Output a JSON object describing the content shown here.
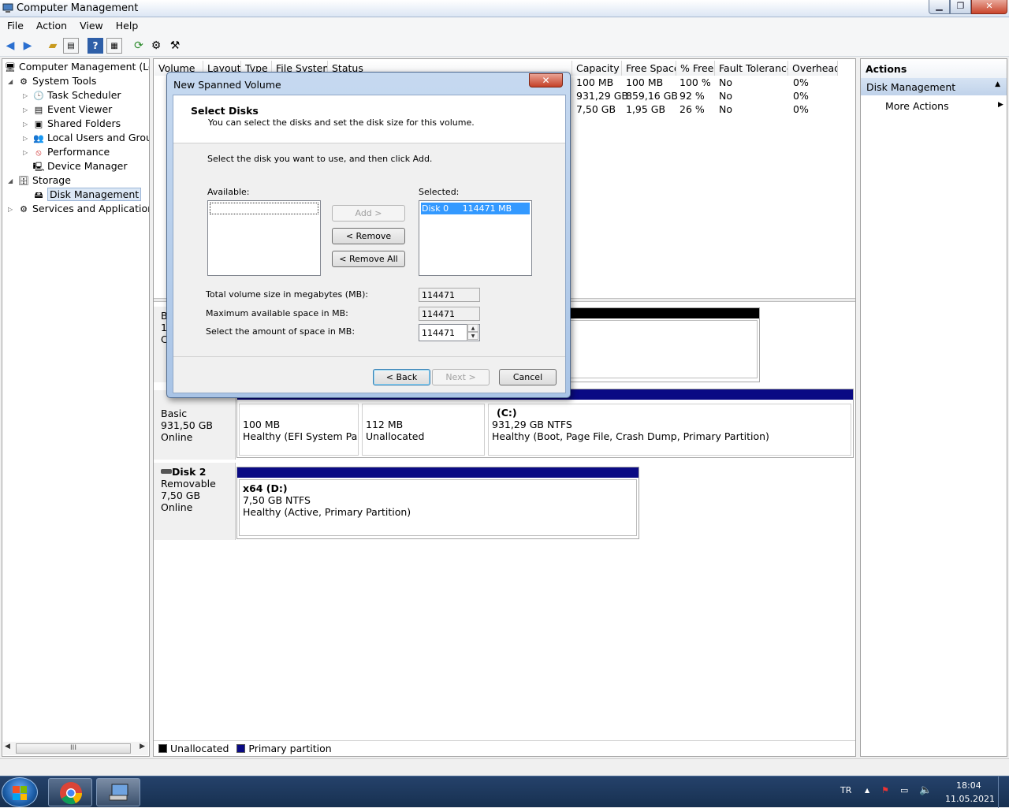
{
  "window": {
    "title": "Computer Management"
  },
  "menu": [
    "File",
    "Action",
    "View",
    "Help"
  ],
  "toolbar": {
    "icons": [
      "back-icon",
      "forward-icon",
      "up-folder-icon",
      "show-hide-tree-icon",
      "help-icon",
      "properties-icon",
      "refresh-icon",
      "connect-icon",
      "settings-icon"
    ]
  },
  "tree": {
    "root": "Computer Management (Local",
    "items": [
      {
        "label": "System Tools",
        "icon": "toolbox-icon"
      },
      {
        "label": "Task Scheduler",
        "icon": "clock-icon"
      },
      {
        "label": "Event Viewer",
        "icon": "event-viewer-icon"
      },
      {
        "label": "Shared Folders",
        "icon": "shared-folder-icon"
      },
      {
        "label": "Local Users and Groups",
        "icon": "users-icon"
      },
      {
        "label": "Performance",
        "icon": "performance-icon"
      },
      {
        "label": "Device Manager",
        "icon": "device-manager-icon"
      },
      {
        "label": "Storage",
        "icon": "storage-icon"
      },
      {
        "label": "Disk Management",
        "icon": "disk-icon"
      },
      {
        "label": "Services and Applications",
        "icon": "services-icon"
      }
    ],
    "scroll_grip": "III"
  },
  "volumes": {
    "columns": [
      "Volume",
      "Layout",
      "Type",
      "File System",
      "Status",
      "Capacity",
      "Free Space",
      "% Free",
      "Fault Tolerance",
      "Overhead"
    ],
    "rows": [
      {
        "capacity": "100 MB",
        "free": "100 MB",
        "pct": "100 %",
        "fault": "No",
        "overhead": "0%"
      },
      {
        "capacity": "931,29 GB",
        "free": "859,16 GB",
        "pct": "92 %",
        "fault": "No",
        "overhead": "0%"
      },
      {
        "capacity": "7,50 GB",
        "free": "1,95 GB",
        "pct": "26 %",
        "fault": "No",
        "overhead": "0%"
      }
    ]
  },
  "disks": {
    "disk0_partial": [
      "B",
      "1",
      "C"
    ],
    "disk1": {
      "type": "Basic",
      "size": "931,50 GB",
      "state": "Online",
      "partitions": [
        {
          "size": "100 MB",
          "status": "Healthy (EFI System Partiti"
        },
        {
          "size": "112 MB",
          "status": "Unallocated"
        },
        {
          "name": "(C:)",
          "size": "931,29 GB NTFS",
          "status": "Healthy (Boot, Page File, Crash Dump, Primary Partition)"
        }
      ]
    },
    "disk2": {
      "name": "Disk 2",
      "type": "Removable",
      "size": "7,50 GB",
      "state": "Online",
      "partition": {
        "name": "x64  (D:)",
        "size": "7,50 GB NTFS",
        "status": "Healthy (Active, Primary Partition)"
      }
    }
  },
  "legend": {
    "unallocated": "Unallocated",
    "primary": "Primary partition",
    "unallocated_color": "#000000",
    "primary_color": "#0a0a84"
  },
  "actions": {
    "header": "Actions",
    "section": "Disk Management",
    "item": "More Actions"
  },
  "dialog": {
    "title": "New Spanned Volume",
    "close": "✕",
    "heading": "Select Disks",
    "subheading": "You can select the disks and set the disk size for this volume.",
    "instruction": "Select the disk you want to use, and then click Add.",
    "available_label": "Available:",
    "selected_label": "Selected:",
    "selected_item": "Disk 0     114471 MB",
    "add": "Add >",
    "remove": "< Remove",
    "remove_all": "< Remove All",
    "total_label": "Total volume size in megabytes (MB):",
    "total_value": "114471",
    "max_label": "Maximum available space in MB:",
    "max_value": "114471",
    "amount_label": "Select the amount of space in MB:",
    "amount_value": "114471",
    "back": "< Back",
    "next": "Next >",
    "cancel": "Cancel"
  },
  "taskbar": {
    "language": "TR",
    "time": "18:04",
    "date": "11.05.2021"
  }
}
